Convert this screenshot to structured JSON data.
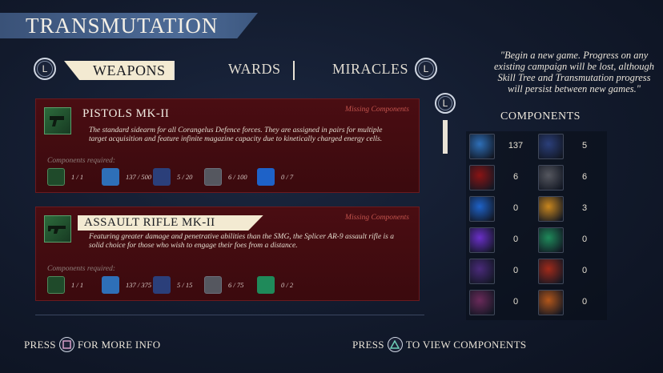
{
  "header": {
    "title": "TRANSMUTATION"
  },
  "tabs": {
    "left_bumper": "L",
    "right_bumper": "L",
    "items": [
      {
        "label": "WEAPONS",
        "active": true
      },
      {
        "label": "WARDS",
        "active": false
      },
      {
        "label": "MIRACLES",
        "active": false
      }
    ]
  },
  "list_bumper": "L",
  "weapons": [
    {
      "name": "PISTOLS MK-II",
      "status": "Missing Components",
      "description": "The standard sidearm for all Corangelus Defence forces. They are assigned in pairs for multiple target acquisition and feature infinite magazine capacity due to kinetically charged energy cells.",
      "requirements_label": "Components required:",
      "requirements": [
        {
          "icon": "pistol-icon",
          "value": "1 / 1"
        },
        {
          "icon": "crystal-icon",
          "value": "137 / 500"
        },
        {
          "icon": "skull-icon",
          "value": "5 / 20"
        },
        {
          "icon": "gear-icon",
          "value": "6 / 100"
        },
        {
          "icon": "blue-feather-icon",
          "value": "0 / 7"
        }
      ]
    },
    {
      "name": "ASSAULT RIFLE MK-II",
      "status": "Missing Components",
      "description": "Featuring greater damage and penetrative abilities than the SMG, the Splicer AR-9 assault rifle is a solid choice for those who wish to engage their foes from a distance.",
      "requirements_label": "Components required:",
      "requirements": [
        {
          "icon": "rifle-icon",
          "value": "1 / 1"
        },
        {
          "icon": "crystal-icon",
          "value": "137 / 375"
        },
        {
          "icon": "skull-icon",
          "value": "5 / 15"
        },
        {
          "icon": "gear-icon",
          "value": "6 / 75"
        },
        {
          "icon": "green-ring-icon",
          "value": "0 / 2"
        }
      ]
    }
  ],
  "quote": "\"Begin a new game. Progress on any existing campaign will be lost, although Skill Tree and Transmutation progress will persist between new games.\"",
  "components": {
    "title": "COMPONENTS",
    "items": [
      {
        "icon": "crystal-icon",
        "count": "137",
        "color": "#2e6fb8"
      },
      {
        "icon": "skull-icon",
        "count": "5",
        "color": "#2b3f7a"
      },
      {
        "icon": "red-splatter-icon",
        "count": "6",
        "color": "#8a1414"
      },
      {
        "icon": "gear-icon",
        "count": "6",
        "color": "#55575f"
      },
      {
        "icon": "blue-feather-icon",
        "count": "0",
        "color": "#1e62c8"
      },
      {
        "icon": "gold-feather-icon",
        "count": "3",
        "color": "#c8861e"
      },
      {
        "icon": "purple-ring-icon",
        "count": "0",
        "color": "#6a2fc8"
      },
      {
        "icon": "green-ring-icon",
        "count": "0",
        "color": "#1f8a5a"
      },
      {
        "icon": "purple-claw-icon",
        "count": "0",
        "color": "#4a2a7a"
      },
      {
        "icon": "red-claw-icon",
        "count": "0",
        "color": "#a02a1a"
      },
      {
        "icon": "purple-flame-icon",
        "count": "0",
        "color": "#6a2a5a"
      },
      {
        "icon": "orange-flame-icon",
        "count": "0",
        "color": "#b2561a"
      }
    ]
  },
  "prompts": {
    "more_info": {
      "press": "PRESS",
      "label": "FOR MORE INFO"
    },
    "view_components": {
      "press": "PRESS",
      "label": "TO VIEW COMPONENTS"
    }
  }
}
